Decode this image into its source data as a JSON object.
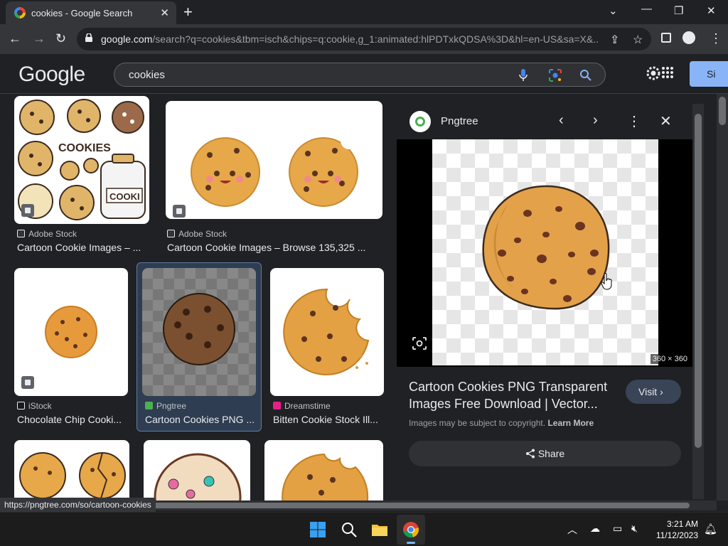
{
  "browser": {
    "tab_title": "cookies - Google Search",
    "url_domain": "google.com",
    "url_rest": "/search?q=cookies&tbm=isch&chips=q:cookie,g_1:animated:hlPDTxkQDSA%3D&hl=en-US&sa=X&..."
  },
  "google": {
    "logo_text": "Google",
    "query": "cookies",
    "signin_label": "Si"
  },
  "results": [
    {
      "source": "Adobe Stock",
      "title": "Cartoon Cookie Images – ...",
      "source_color": "#e8eaed"
    },
    {
      "source": "Adobe Stock",
      "title": "Cartoon Cookie Images – Browse 135,325 ...",
      "source_color": "#e8eaed"
    },
    {
      "source": "iStock",
      "title": "Chocolate Chip Cooki...",
      "source_color": "#e8eaed"
    },
    {
      "source": "Pngtree",
      "title": "Cartoon Cookies PNG ...",
      "source_color": "#4caf50"
    },
    {
      "source": "Dreamstime",
      "title": "Bitten Cookie Stock Ill...",
      "source_color": "#e91e8c"
    }
  ],
  "thumb_text": {
    "cookies_word": "COOKIES",
    "jar_label": "COOKI"
  },
  "panel": {
    "source_name": "Pngtree",
    "dimensions": "360 × 360",
    "title": "Cartoon Cookies PNG Transparent Images Free Download | Vector...",
    "visit_label": "Visit",
    "copyright_text": "Images may be subject to copyright.",
    "learn_more": "Learn More",
    "share_label": "Share"
  },
  "status_url": "https://pngtree.com/so/cartoon-cookies",
  "taskbar": {
    "time": "3:21 AM",
    "date": "11/12/2023"
  }
}
